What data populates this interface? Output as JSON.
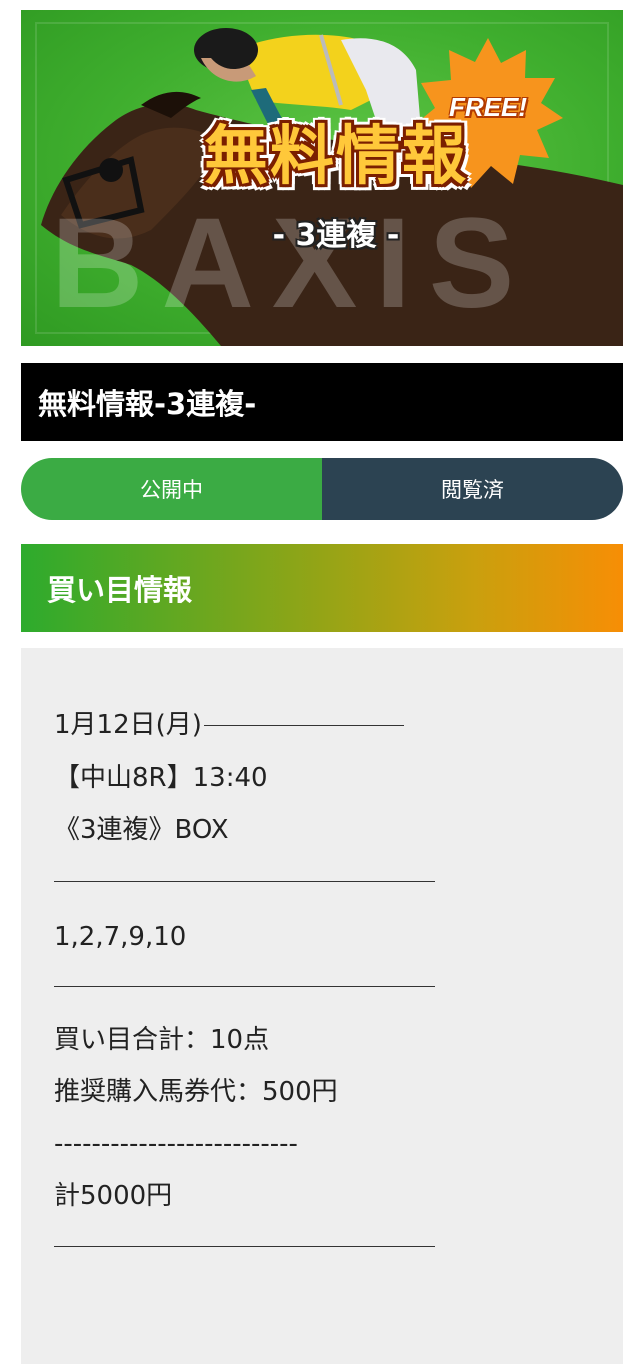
{
  "banner": {
    "title": "無料情報",
    "subtitle": "- 3連複 -",
    "badge": "FREE!",
    "background_word": "BAXIS",
    "colors": {
      "field": "#3fae2e",
      "title": "#ffc83a",
      "badge": "#f7941d"
    }
  },
  "page": {
    "title": "無料情報-3連複-"
  },
  "tabs": [
    {
      "label": "公開中",
      "color": "#3bab44"
    },
    {
      "label": "閲覧済",
      "color": "#2c4352"
    }
  ],
  "section": {
    "header": "買い目情報"
  },
  "content": {
    "date": "1月12日(月)",
    "race": "【中山8R】13:40",
    "bet_type": "《3連複》BOX",
    "numbers": "1,2,7,9,10",
    "total_points": "買い目合計：10点",
    "recommended": "推奨購入馬券代：500円",
    "dash_separator": "--------------------------",
    "total_amount": "計5000円"
  }
}
